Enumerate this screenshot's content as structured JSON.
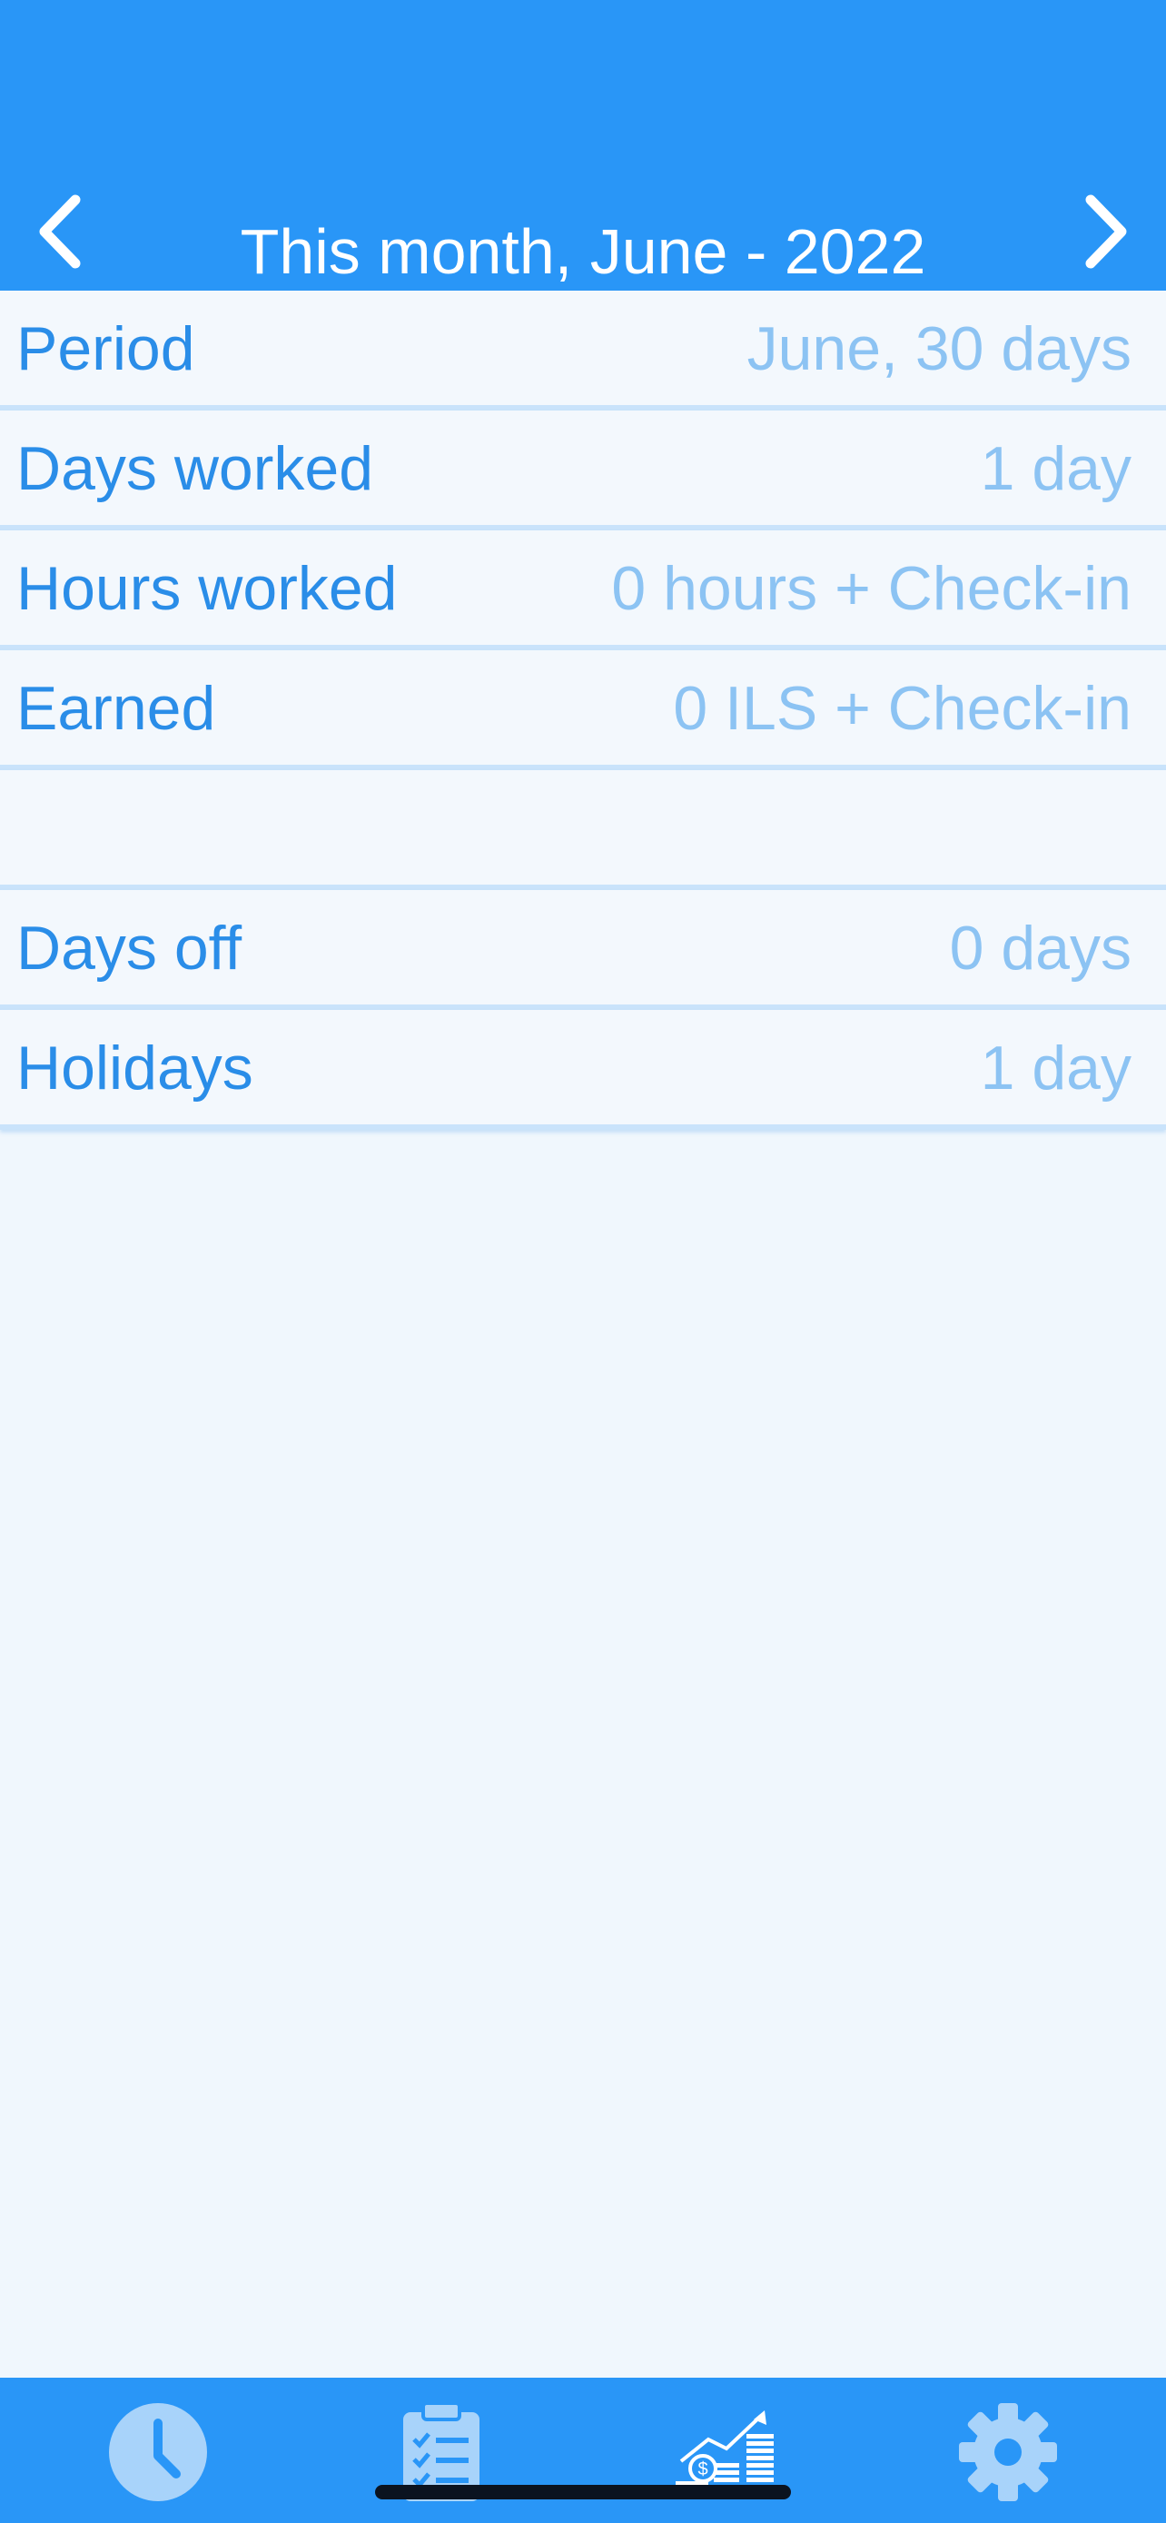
{
  "header": {
    "title": "This month, June - 2022",
    "prev_icon": "chevron-left-icon",
    "next_icon": "chevron-right-icon"
  },
  "summary": {
    "rows": [
      {
        "label": "Period",
        "value": "June, 30 days"
      },
      {
        "label": "Days worked",
        "value": "1 day"
      },
      {
        "label": "Hours worked",
        "value": "0 hours + Check-in"
      },
      {
        "label": "Earned",
        "value": "0 ILS + Check-in"
      },
      {
        "label": "",
        "value": ""
      },
      {
        "label": "Days off",
        "value": "0 days"
      },
      {
        "label": "Holidays",
        "value": "1 day"
      }
    ]
  },
  "tabbar": {
    "tabs": [
      {
        "icon": "clock-icon"
      },
      {
        "icon": "clipboard-checklist-icon"
      },
      {
        "icon": "earnings-chart-icon"
      },
      {
        "icon": "gear-icon"
      }
    ],
    "active_index": 2
  },
  "colors": {
    "primary": "#2996f7",
    "label": "#2a8de8",
    "value": "#8cc3f3",
    "background": "#f0f7fd"
  }
}
